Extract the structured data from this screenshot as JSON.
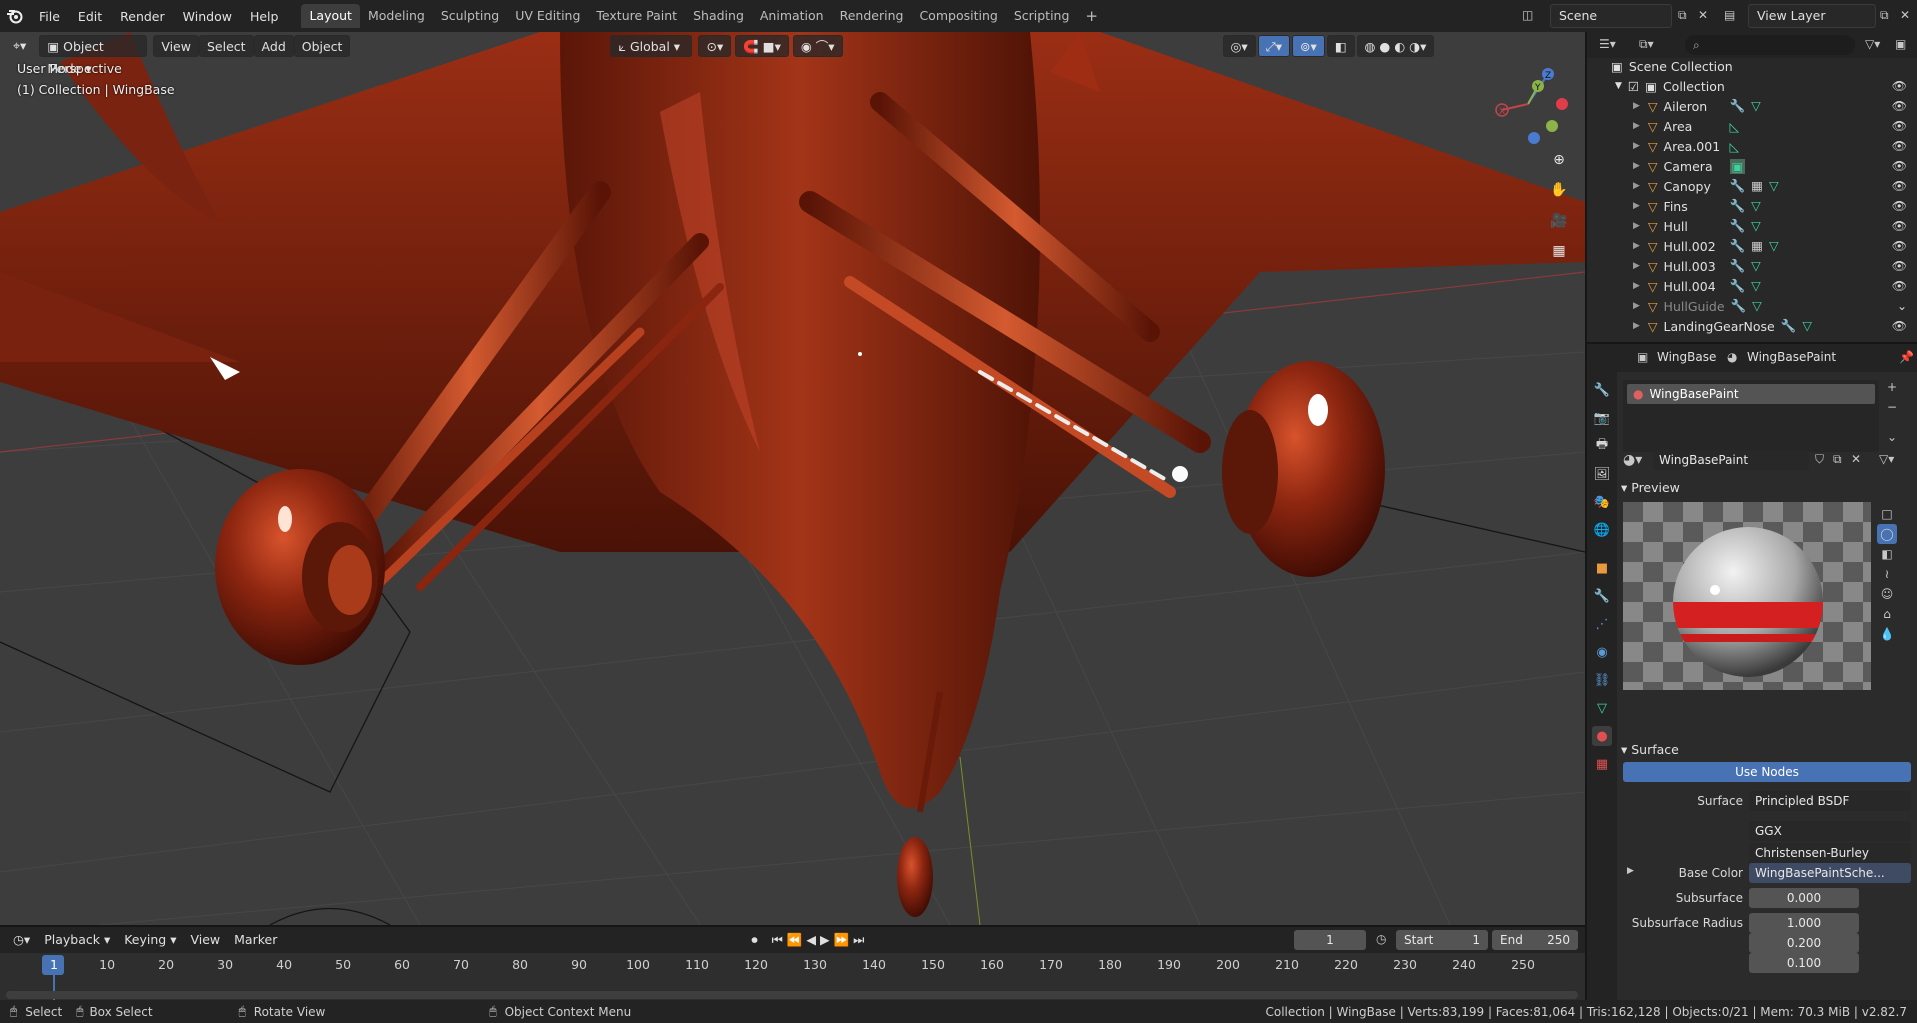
{
  "topbar": {
    "menus": [
      "File",
      "Edit",
      "Render",
      "Window",
      "Help"
    ],
    "workspaces": [
      "Layout",
      "Modeling",
      "Sculpting",
      "UV Editing",
      "Texture Paint",
      "Shading",
      "Animation",
      "Rendering",
      "Compositing",
      "Scripting"
    ],
    "active_workspace": "Layout",
    "scene": "Scene",
    "view_layer": "View Layer"
  },
  "viewport": {
    "mode": "Object Mode",
    "menus": [
      "View",
      "Select",
      "Add",
      "Object"
    ],
    "orientation": "Global",
    "perspective_label": "User Perspective",
    "collection_label": "(1) Collection | WingBase"
  },
  "outliner": {
    "search_placeholder": "",
    "scene_collection": "Scene Collection",
    "collection": "Collection",
    "items": [
      {
        "name": "Aileron",
        "icons": "wrench-mesh"
      },
      {
        "name": "Area",
        "icons": "light"
      },
      {
        "name": "Area.001",
        "icons": "light"
      },
      {
        "name": "Camera",
        "icons": "camera"
      },
      {
        "name": "Canopy",
        "icons": "wrench-modifier-mesh"
      },
      {
        "name": "Fins",
        "icons": "wrench-mesh"
      },
      {
        "name": "Hull",
        "icons": "wrench-mesh"
      },
      {
        "name": "Hull.002",
        "icons": "wrench-modifier-mesh"
      },
      {
        "name": "Hull.003",
        "icons": "wrench-mesh"
      },
      {
        "name": "Hull.004",
        "icons": "wrench-mesh"
      },
      {
        "name": "HullGuide",
        "icons": "wrench-mesh"
      },
      {
        "name": "LandingGearNose",
        "icons": "wrench-mesh"
      }
    ]
  },
  "properties": {
    "object_name": "WingBase",
    "material_name": "WingBasePaint",
    "slot_name": "WingBasePaint",
    "datablock_name": "WingBasePaint",
    "preview_label": "Preview",
    "surface_label": "Surface",
    "use_nodes": "Use Nodes",
    "surface_field_label": "Surface",
    "surface_value": "Principled BSDF",
    "distribution": "GGX",
    "subsurface_method": "Christensen-Burley",
    "base_color_label": "Base Color",
    "base_color_value": "WingBasePaintSche...",
    "subsurface_label": "Subsurface",
    "subsurface_value": "0.000",
    "subsurface_radius_label": "Subsurface Radius",
    "subsurface_radius": [
      "1.000",
      "0.200",
      "0.100"
    ]
  },
  "timeline": {
    "menus": [
      "Playback",
      "Keying",
      "View",
      "Marker"
    ],
    "current_frame": "1",
    "start_label": "Start",
    "start_value": "1",
    "end_label": "End",
    "end_value": "250",
    "ticks": [
      "1",
      "10",
      "20",
      "30",
      "40",
      "50",
      "60",
      "70",
      "80",
      "90",
      "100",
      "110",
      "120",
      "130",
      "140",
      "150",
      "160",
      "170",
      "180",
      "190",
      "200",
      "210",
      "220",
      "230",
      "240",
      "250"
    ]
  },
  "status": {
    "select": "Select",
    "box_select": "Box Select",
    "rotate_view": "Rotate View",
    "context_menu": "Object Context Menu",
    "stats": "Collection | WingBase | Verts:83,199 | Faces:81,064 | Tris:162,128 | Objects:0/21 | Mem: 70.3 MiB | v2.82.7"
  },
  "colors": {
    "accent": "#4772b3",
    "mesh_icon": "#3cd3a0",
    "object_icon": "#e89a3c",
    "plane_red": "#8e2410"
  }
}
